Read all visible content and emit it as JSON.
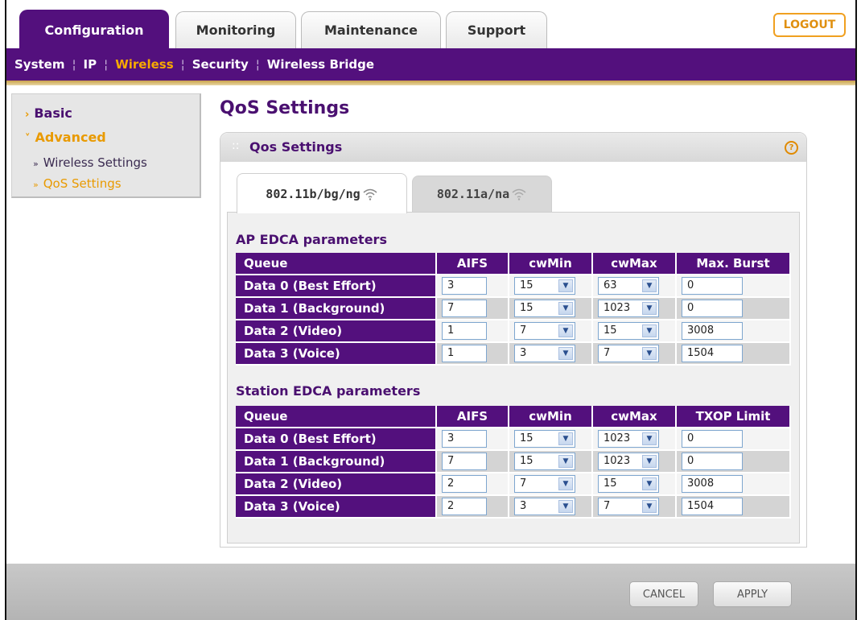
{
  "top_tabs": [
    "Configuration",
    "Monitoring",
    "Maintenance",
    "Support"
  ],
  "logout_label": "LOGOUT",
  "subnav": [
    "System",
    "IP",
    "Wireless",
    "Security",
    "Wireless Bridge"
  ],
  "left_menu": {
    "basic": "Basic",
    "advanced": "Advanced",
    "wireless_settings": "Wireless Settings",
    "qos_settings": "QoS Settings"
  },
  "page_title": "QoS Settings",
  "panel_title": "Qos Settings",
  "band_tabs": [
    "802.11b/bg/ng",
    "802.11a/na"
  ],
  "ap": {
    "title": "AP EDCA parameters",
    "headers": [
      "Queue",
      "AIFS",
      "cwMin",
      "cwMax",
      "Max. Burst"
    ],
    "rows": [
      {
        "queue": "Data 0 (Best Effort)",
        "aifs": "3",
        "cwmin": "15",
        "cwmax": "63",
        "last": "0"
      },
      {
        "queue": "Data 1 (Background)",
        "aifs": "7",
        "cwmin": "15",
        "cwmax": "1023",
        "last": "0"
      },
      {
        "queue": "Data 2 (Video)",
        "aifs": "1",
        "cwmin": "7",
        "cwmax": "15",
        "last": "3008"
      },
      {
        "queue": "Data 3 (Voice)",
        "aifs": "1",
        "cwmin": "3",
        "cwmax": "7",
        "last": "1504"
      }
    ]
  },
  "station": {
    "title": "Station EDCA parameters",
    "headers": [
      "Queue",
      "AIFS",
      "cwMin",
      "cwMax",
      "TXOP Limit"
    ],
    "rows": [
      {
        "queue": "Data 0 (Best Effort)",
        "aifs": "3",
        "cwmin": "15",
        "cwmax": "1023",
        "last": "0"
      },
      {
        "queue": "Data 1 (Background)",
        "aifs": "7",
        "cwmin": "15",
        "cwmax": "1023",
        "last": "0"
      },
      {
        "queue": "Data 2 (Video)",
        "aifs": "2",
        "cwmin": "7",
        "cwmax": "15",
        "last": "3008"
      },
      {
        "queue": "Data 3 (Voice)",
        "aifs": "2",
        "cwmin": "3",
        "cwmax": "7",
        "last": "1504"
      }
    ]
  },
  "buttons": {
    "cancel": "CANCEL",
    "apply": "APPLY"
  }
}
